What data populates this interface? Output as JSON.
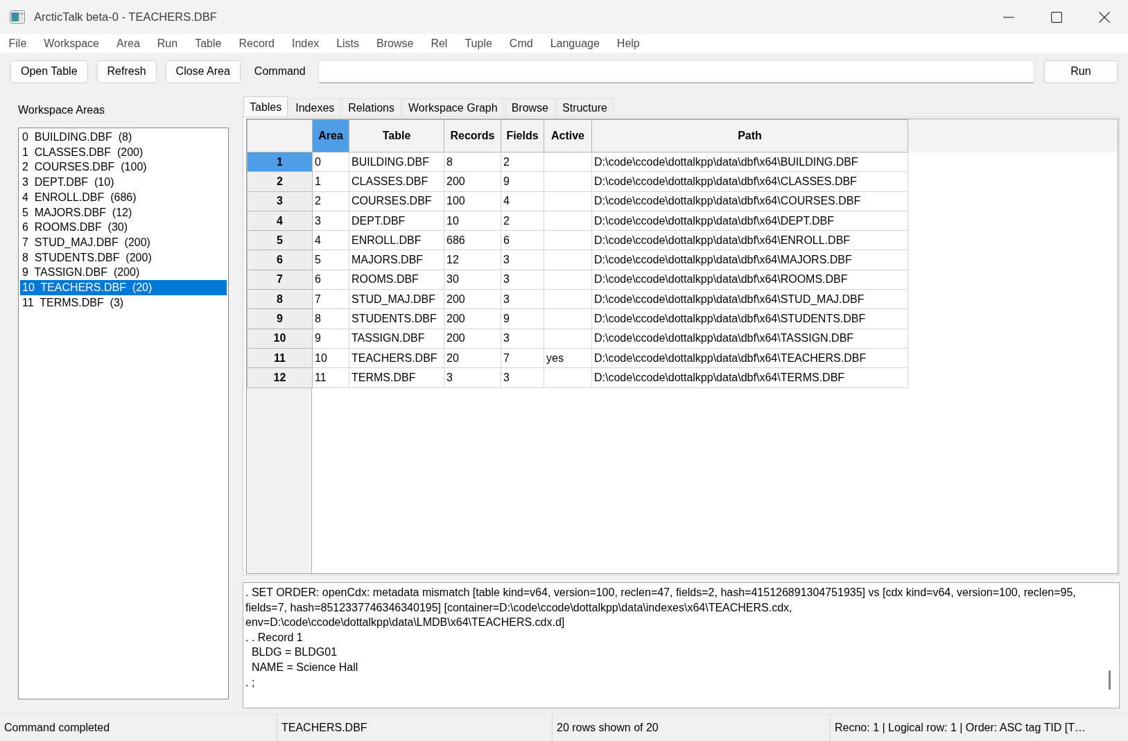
{
  "window": {
    "title": "ArcticTalk beta-0 - TEACHERS.DBF"
  },
  "menu": [
    "File",
    "Workspace",
    "Area",
    "Run",
    "Table",
    "Record",
    "Index",
    "Lists",
    "Browse",
    "Rel",
    "Tuple",
    "Cmd",
    "Language",
    "Help"
  ],
  "toolbar": {
    "buttons": [
      "Open Table",
      "Refresh",
      "Close Area"
    ],
    "command": {
      "label": "Command"
    },
    "run_button": "Run"
  },
  "workspace_areas": {
    "title": "Workspace Areas",
    "items": [
      {
        "label": "0  BUILDING.DBF  (8)",
        "selected": false
      },
      {
        "label": "1  CLASSES.DBF  (200)",
        "selected": false
      },
      {
        "label": "2  COURSES.DBF  (100)",
        "selected": false
      },
      {
        "label": "3  DEPT.DBF  (10)",
        "selected": false
      },
      {
        "label": "4  ENROLL.DBF  (686)",
        "selected": false
      },
      {
        "label": "5  MAJORS.DBF  (12)",
        "selected": false
      },
      {
        "label": "6  ROOMS.DBF  (30)",
        "selected": false
      },
      {
        "label": "7  STUD_MAJ.DBF  (200)",
        "selected": false
      },
      {
        "label": "8  STUDENTS.DBF  (200)",
        "selected": false
      },
      {
        "label": "9  TASSIGN.DBF  (200)",
        "selected": false
      },
      {
        "label": "10  TEACHERS.DBF  (20)",
        "selected": true
      },
      {
        "label": "11  TERMS.DBF  (3)",
        "selected": false
      }
    ]
  },
  "tabs": [
    {
      "label": "Tables",
      "selected": true
    },
    {
      "label": "Indexes",
      "selected": false
    },
    {
      "label": "Relations",
      "selected": false
    },
    {
      "label": "Workspace Graph",
      "selected": false
    },
    {
      "label": "Browse",
      "selected": false
    },
    {
      "label": "Structure",
      "selected": false
    }
  ],
  "table": {
    "columns": [
      {
        "label": "Area",
        "selected": true
      },
      {
        "label": "Table",
        "selected": false
      },
      {
        "label": "Records",
        "selected": false
      },
      {
        "label": "Fields",
        "selected": false
      },
      {
        "label": "Active",
        "selected": false
      },
      {
        "label": "Path",
        "selected": false
      }
    ],
    "rows": [
      {
        "number": "1",
        "selected": true,
        "area": "0",
        "table": "BUILDING.DBF",
        "records": "8",
        "fields": "2",
        "path": "D:\\code\\ccode\\dottalkpp\\data\\dbf\\x64\\BUILDING.DBF"
      },
      {
        "number": "2",
        "selected": false,
        "area": "1",
        "table": "CLASSES.DBF",
        "records": "200",
        "fields": "9",
        "path": "D:\\code\\ccode\\dottalkpp\\data\\dbf\\x64\\CLASSES.DBF"
      },
      {
        "number": "3",
        "selected": false,
        "area": "2",
        "table": "COURSES.DBF",
        "records": "100",
        "fields": "4",
        "path": "D:\\code\\ccode\\dottalkpp\\data\\dbf\\x64\\COURSES.DBF"
      },
      {
        "number": "4",
        "selected": false,
        "area": "3",
        "table": "DEPT.DBF",
        "records": "10",
        "fields": "2",
        "path": "D:\\code\\ccode\\dottalkpp\\data\\dbf\\x64\\DEPT.DBF"
      },
      {
        "number": "5",
        "selected": false,
        "area": "4",
        "table": "ENROLL.DBF",
        "records": "686",
        "fields": "6",
        "path": "D:\\code\\ccode\\dottalkpp\\data\\dbf\\x64\\ENROLL.DBF"
      },
      {
        "number": "6",
        "selected": false,
        "area": "5",
        "table": "MAJORS.DBF",
        "records": "12",
        "fields": "3",
        "path": "D:\\code\\ccode\\dottalkpp\\data\\dbf\\x64\\MAJORS.DBF"
      },
      {
        "number": "7",
        "selected": false,
        "area": "6",
        "table": "ROOMS.DBF",
        "records": "30",
        "fields": "3",
        "path": "D:\\code\\ccode\\dottalkpp\\data\\dbf\\x64\\ROOMS.DBF"
      },
      {
        "number": "8",
        "selected": false,
        "area": "7",
        "table": "STUD_MAJ.DBF",
        "records": "200",
        "fields": "3",
        "path": "D:\\code\\ccode\\dottalkpp\\data\\dbf\\x64\\STUD_MAJ.DBF"
      },
      {
        "number": "9",
        "selected": false,
        "area": "8",
        "table": "STUDENTS.DBF",
        "records": "200",
        "fields": "9",
        "path": "D:\\code\\ccode\\dottalkpp\\data\\dbf\\x64\\STUDENTS.DBF"
      },
      {
        "number": "10",
        "selected": false,
        "area": "9",
        "table": "TASSIGN.DBF",
        "records": "200",
        "fields": "3",
        "path": "D:\\code\\ccode\\dottalkpp\\data\\dbf\\x64\\TASSIGN.DBF"
      },
      {
        "number": "11",
        "selected": false,
        "area": "10",
        "table": "TEACHERS.DBF",
        "records": "20",
        "fields": "7",
        "active": "yes",
        "path": "D:\\code\\ccode\\dottalkpp\\data\\dbf\\x64\\TEACHERS.DBF"
      },
      {
        "number": "12",
        "selected": false,
        "area": "11",
        "table": "TERMS.DBF",
        "records": "3",
        "fields": "3",
        "path": "D:\\code\\ccode\\dottalkpp\\data\\dbf\\x64\\TERMS.DBF"
      }
    ]
  },
  "log": {
    "lines": [
      ". SET ORDER: openCdx: metadata mismatch [table kind=v64, version=100, reclen=47, fields=2, hash=415126891304751935] vs [cdx kind=v64, version=100, reclen=95, fields=7, hash=8512337746346340195] [container=D:\\code\\ccode\\dottalkpp\\data\\indexes\\x64\\TEACHERS.cdx, env=D:\\code\\ccode\\dottalkpp\\data\\LMDB\\x64\\TEACHERS.cdx.d]",
      ". . Record 1",
      "  BLDG = BLDG01",
      "  NAME = Science Hall",
      ". ;"
    ]
  },
  "status_bar": [
    "Command completed",
    "TEACHERS.DBF",
    "20 rows shown of 20",
    "Recno: 1 | Logical row: 1 | Order: ASC tag TID [T…"
  ]
}
